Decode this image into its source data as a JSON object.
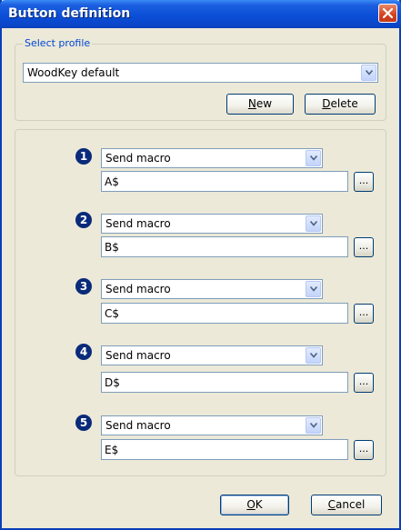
{
  "window": {
    "title": "Button definition"
  },
  "profile": {
    "legend": "Select profile",
    "selected": "WoodKey default",
    "new_label_u": "N",
    "new_label_rest": "ew",
    "delete_label_u": "D",
    "delete_label_rest": "elete"
  },
  "buttons": [
    {
      "number": "1",
      "action": "Send macro",
      "value": "A$",
      "browse": "..."
    },
    {
      "number": "2",
      "action": "Send macro",
      "value": "B$",
      "browse": "..."
    },
    {
      "number": "3",
      "action": "Send macro",
      "value": "C$",
      "browse": "..."
    },
    {
      "number": "4",
      "action": "Send macro",
      "value": "D$",
      "browse": "..."
    },
    {
      "number": "5",
      "action": "Send macro",
      "value": "E$",
      "browse": "..."
    }
  ],
  "footer": {
    "ok_u": "O",
    "ok_rest": "K",
    "cancel_u": "C",
    "cancel_rest": "ancel"
  },
  "colors": {
    "titlebar": "#0a45c8",
    "legend": "#0046d5",
    "badge": "#0a2a7a",
    "close": "#d5411c"
  }
}
